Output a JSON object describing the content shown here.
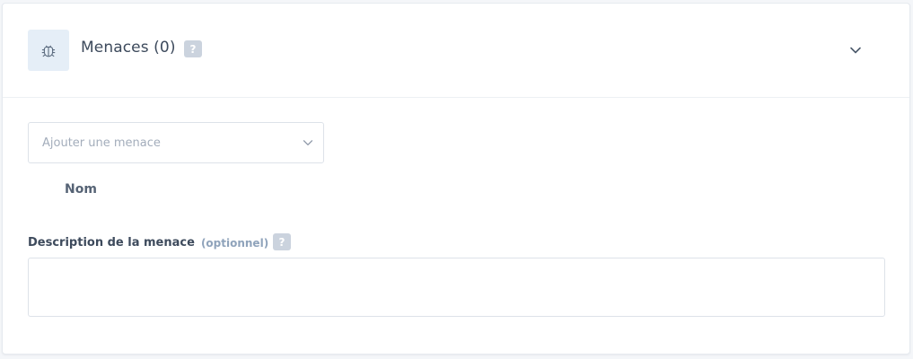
{
  "header": {
    "icon": "bug-icon",
    "title": "Menaces (0)",
    "help": "?",
    "toggle_icon": "chevron-down-icon"
  },
  "add_threat_select": {
    "placeholder": "Ajouter une menace",
    "chevron_icon": "chevron-down-icon"
  },
  "table": {
    "columns": [
      "Nom"
    ]
  },
  "description_field": {
    "label": "Description de la menace",
    "optional": "(optionnel)",
    "help": "?",
    "value": ""
  },
  "colors": {
    "icon_bg": "#e5eef7",
    "text_primary": "#3d4a5c",
    "text_muted": "#a3adbb",
    "optional_text": "#8fa3bb",
    "help_badge": "#cbd3de",
    "border": "#dde2e9"
  }
}
